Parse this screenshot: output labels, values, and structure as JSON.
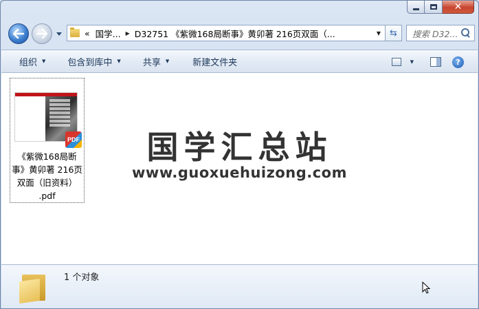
{
  "window": {
    "caption_buttons": {
      "minimize": "minimize",
      "maximize": "maximize",
      "close": "close"
    }
  },
  "address_bar": {
    "overflow": "«",
    "segments": [
      "国学...",
      "D32751 《紫微168局断事》黄卯著 216页双面（..."
    ],
    "search_placeholder": "搜索 D32..."
  },
  "toolbar": {
    "organize_label": "组织",
    "include_label": "包含到库中",
    "share_label": "共享",
    "new_folder_label": "新建文件夹"
  },
  "file": {
    "name_lines": [
      "《紫微168局断",
      "事》黄卯著 216页",
      "双面（旧资料）",
      ".pdf"
    ],
    "thumb_badge": "PDF"
  },
  "watermark": {
    "title": "国学汇总站",
    "url": "www.guoxuehuizong.com"
  },
  "status": {
    "text": "1 个对象"
  },
  "colors": {
    "accent": "#1e395b",
    "close": "#c7452f",
    "pdf_red": "#c0141b"
  }
}
